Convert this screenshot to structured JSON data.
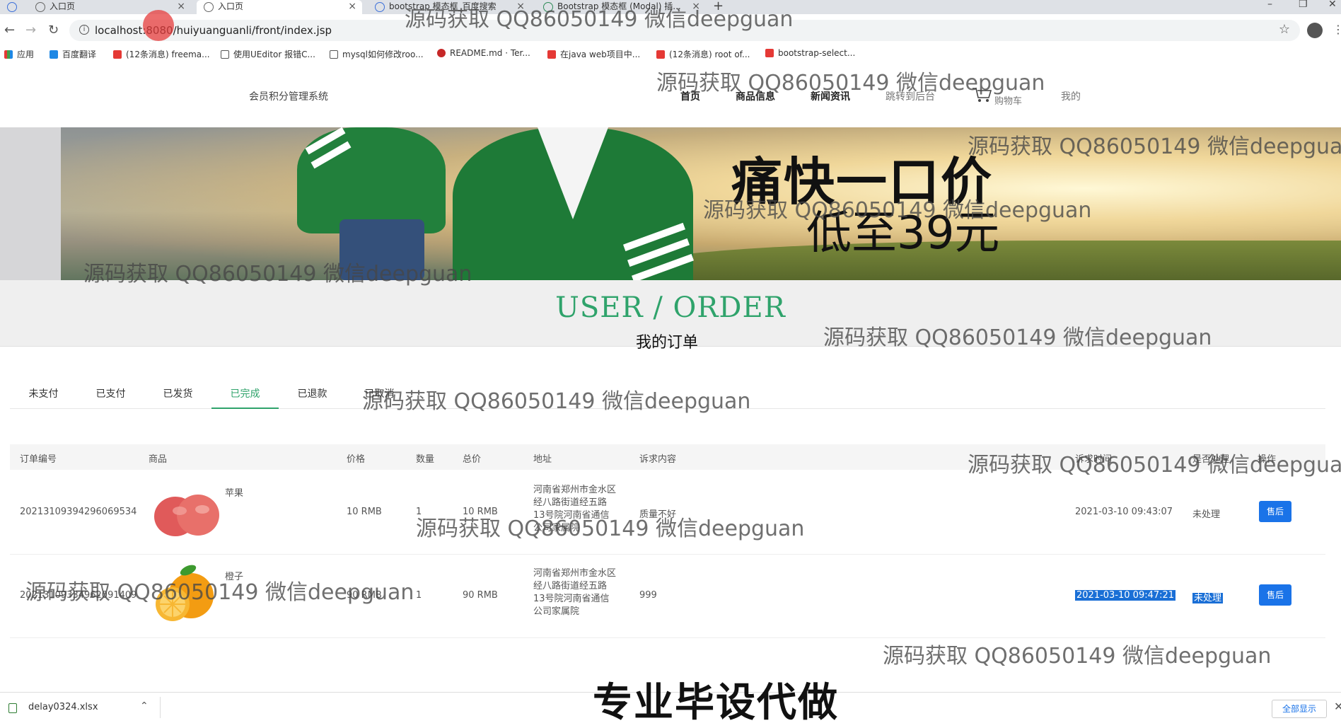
{
  "browser": {
    "tabs": [
      {
        "label": "",
        "active": false
      },
      {
        "label": "入口页",
        "active": false
      },
      {
        "label": "入口页",
        "active": true
      },
      {
        "label": "bootstrap 模态框_百度搜索",
        "active": false
      },
      {
        "label": "Bootstrap 模态框 (Modal) 插...",
        "active": false
      }
    ],
    "new_tab": "+",
    "close_glyph": "×",
    "url_host": "localhost:8080",
    "url_path": "/huiyuanguanli/front/index.jsp",
    "bookmarks": [
      {
        "label": "应用",
        "color": "#e53935"
      },
      {
        "label": "百度翻译",
        "color": "#1e88e5"
      },
      {
        "label": "(12条消息) freema...",
        "color": "#e53935"
      },
      {
        "label": "使用UEditor 报错C...",
        "color": "#555555"
      },
      {
        "label": "mysql如何修改roo...",
        "color": "#555555"
      },
      {
        "label": "README.md · Ter...",
        "color": "#c62828"
      },
      {
        "label": "在java web项目中...",
        "color": "#e53935"
      },
      {
        "label": "(12条消息) root of...",
        "color": "#e53935"
      },
      {
        "label": "bootstrap-select...",
        "color": "#e53935"
      }
    ]
  },
  "site": {
    "title": "会员积分管理系统",
    "nav": [
      "首页",
      "商品信息",
      "新闻资讯",
      "跳转到后台",
      "购物车",
      "我的"
    ]
  },
  "banner": {
    "headline": "痛快一口价",
    "subline": "低至39元"
  },
  "section": {
    "title_en": "USER / ORDER",
    "title_cn": "我的订单"
  },
  "order_tabs": [
    "未支付",
    "已支付",
    "已发货",
    "已完成",
    "已退款",
    "已取消"
  ],
  "active_tab": "已完成",
  "table": {
    "headers": [
      "订单编号",
      "商品",
      "价格",
      "数量",
      "总价",
      "地址",
      "诉求内容",
      "诉求时间",
      "是否处理",
      "操作"
    ],
    "rows": [
      {
        "order_no": "20213109394296069534",
        "product": "苹果",
        "price": "10 RMB",
        "qty": "1",
        "total": "10 RMB",
        "address": "河南省郑州市金水区经八路街道经五路13号院河南省通信公司家属院",
        "request": "质量不好",
        "request_time": "2021-03-10 09:43:07",
        "status": "未处理",
        "action": "售后"
      },
      {
        "order_no": "20213109334962091409",
        "product": "橙子",
        "price": "90 RMB",
        "qty": "1",
        "total": "90 RMB",
        "address": "河南省郑州市金水区经八路街道经五路13号院河南省通信公司家属院",
        "request": "999",
        "request_time": "2021-03-10 09:47:21",
        "status": "未处理",
        "action": "售后"
      }
    ]
  },
  "downloads": {
    "file": "delay0324.xlsx",
    "show_all": "全部显示"
  },
  "watermark": "源码获取 QQ86050149 微信deepguan",
  "caption": "专业毕设代做"
}
